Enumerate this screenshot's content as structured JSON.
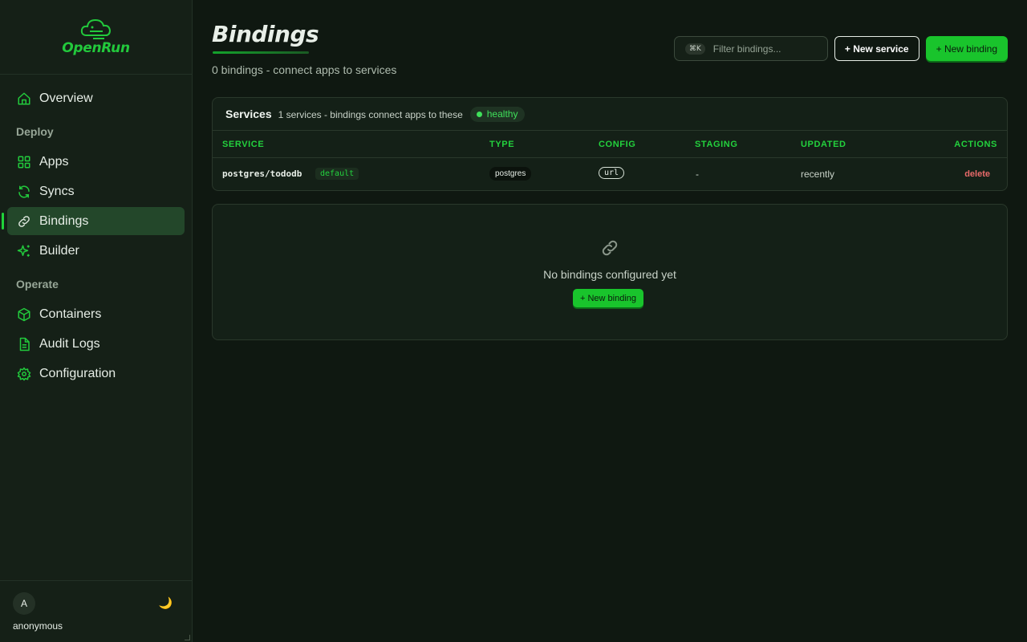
{
  "brand": {
    "name": "OpenRun",
    "accent": "#1fd23a"
  },
  "sidebar": {
    "overview": {
      "label": "Overview",
      "icon": "home-icon"
    },
    "deploy_section": "Deploy",
    "apps": {
      "label": "Apps",
      "icon": "grid-icon"
    },
    "syncs": {
      "label": "Syncs",
      "icon": "refresh-icon"
    },
    "bindings": {
      "label": "Bindings",
      "icon": "link-icon",
      "active": true
    },
    "builder": {
      "label": "Builder",
      "icon": "sparkle-icon"
    },
    "operate_section": "Operate",
    "containers": {
      "label": "Containers",
      "icon": "box-icon"
    },
    "audit_logs": {
      "label": "Audit Logs",
      "icon": "document-icon"
    },
    "configuration": {
      "label": "Configuration",
      "icon": "gear-icon"
    },
    "user": {
      "avatar_letter": "A",
      "name": "anonymous",
      "theme_icon": "🌙"
    }
  },
  "header": {
    "title": "Bindings",
    "subtitle": "0 bindings - connect apps to services",
    "filter_shortcut": "⌘K",
    "filter_placeholder": "Filter bindings...",
    "new_service_label": "+ New service",
    "new_binding_label": "+ New binding"
  },
  "services": {
    "title": "Services",
    "meta": "1 services - bindings connect apps to these",
    "status": "healthy",
    "columns": {
      "service": "SERVICE",
      "type": "TYPE",
      "config": "CONFIG",
      "staging": "STAGING",
      "updated": "UPDATED",
      "actions": "ACTIONS"
    },
    "rows": [
      {
        "service": "postgres/tododb",
        "tag": "default",
        "type": "postgres",
        "config": "url",
        "staging": "-",
        "updated": "recently",
        "action": "delete"
      }
    ]
  },
  "empty_state": {
    "icon": "🔗",
    "message": "No bindings configured yet",
    "button_label": "+ New binding"
  }
}
